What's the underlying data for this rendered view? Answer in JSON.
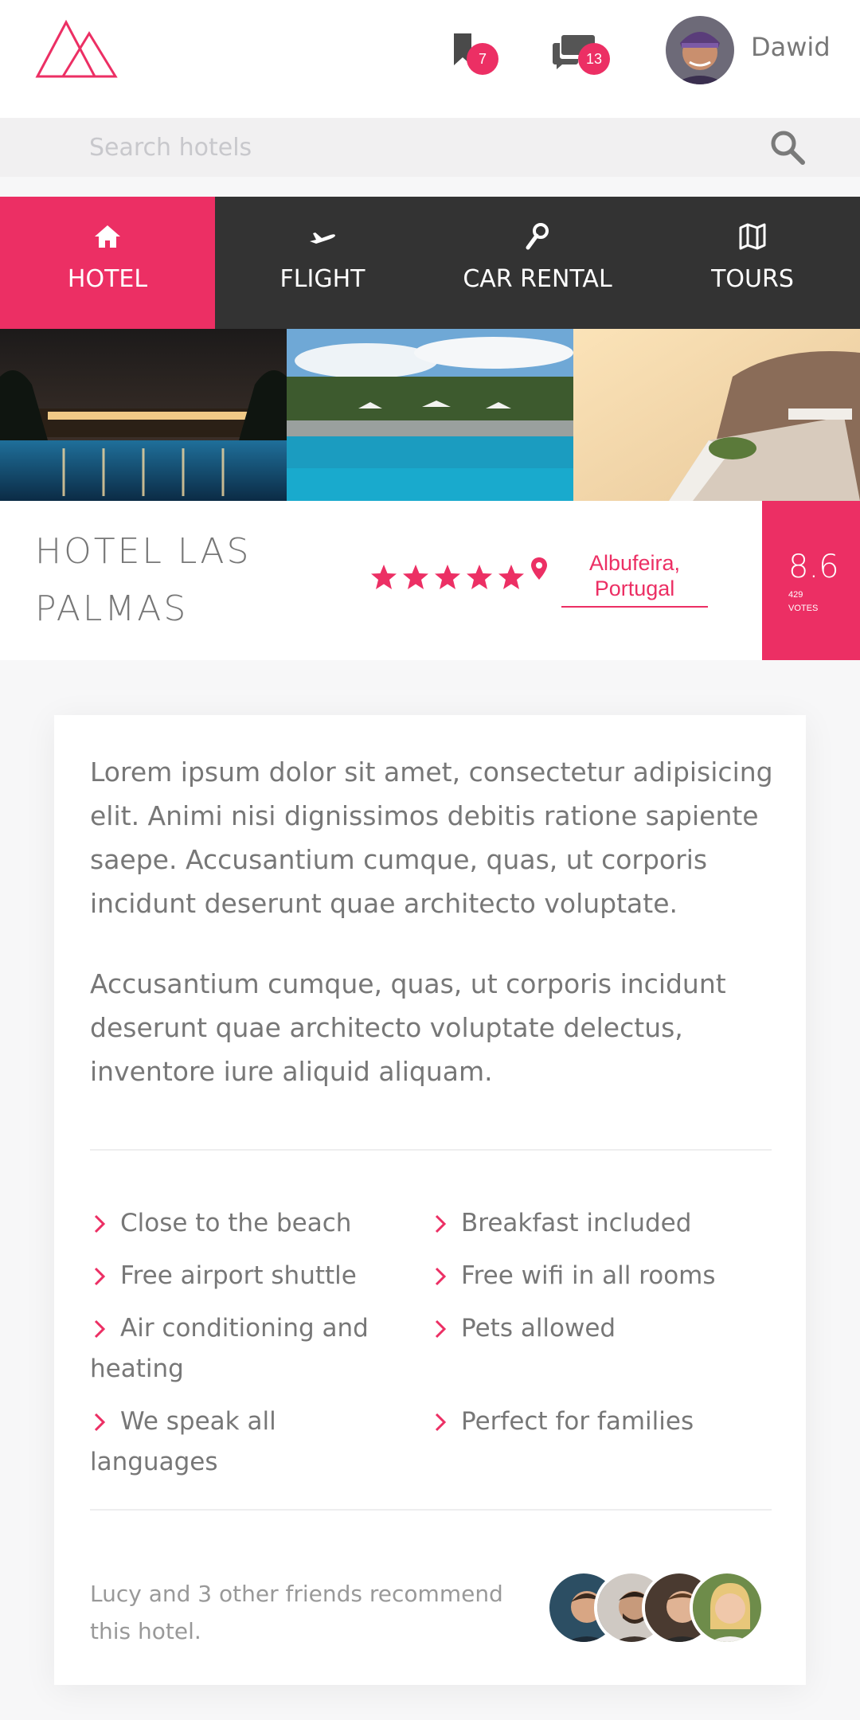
{
  "header": {
    "logo": "mountain-logo",
    "bookmarks_count": "7",
    "messages_count": "13",
    "user_name": "Dawid"
  },
  "search": {
    "placeholder": "Search hotels",
    "value": ""
  },
  "tabs": [
    {
      "label": "HOTEL",
      "icon": "home-icon",
      "active": true
    },
    {
      "label": "FLIGHT",
      "icon": "plane-icon",
      "active": false
    },
    {
      "label": "CAR RENTAL",
      "icon": "key-icon",
      "active": false
    },
    {
      "label": "TOURS",
      "icon": "map-icon",
      "active": false
    }
  ],
  "hotel": {
    "name": "HOTEL LAS PALMAS",
    "stars": 5,
    "location": "Albufeira, Portugal",
    "score": "8.6",
    "votes_count": "429",
    "votes_label": "VOTES"
  },
  "description": {
    "p1": "Lorem ipsum dolor sit amet, consectetur adipisicing elit. Animi nisi dignissimos debitis ratione sapiente saepe. Accusantium cumque, quas, ut corporis incidunt deserunt quae architecto voluptate.",
    "p2": "Accusantium cumque, quas, ut corporis incidunt deserunt quae architecto voluptate delectus, inventore iure aliquid aliquam."
  },
  "features": [
    "Close to the beach",
    "Breakfast included",
    "Free airport shuttle",
    "Free wifi in all rooms",
    "Air conditioning and heating",
    "Pets allowed",
    "We speak all languages",
    "Perfect for families"
  ],
  "recommend": "Lucy and 3 other friends recommend this hotel.",
  "colors": {
    "accent": "#ec2f64",
    "dark": "#333333",
    "text": "#777777"
  }
}
